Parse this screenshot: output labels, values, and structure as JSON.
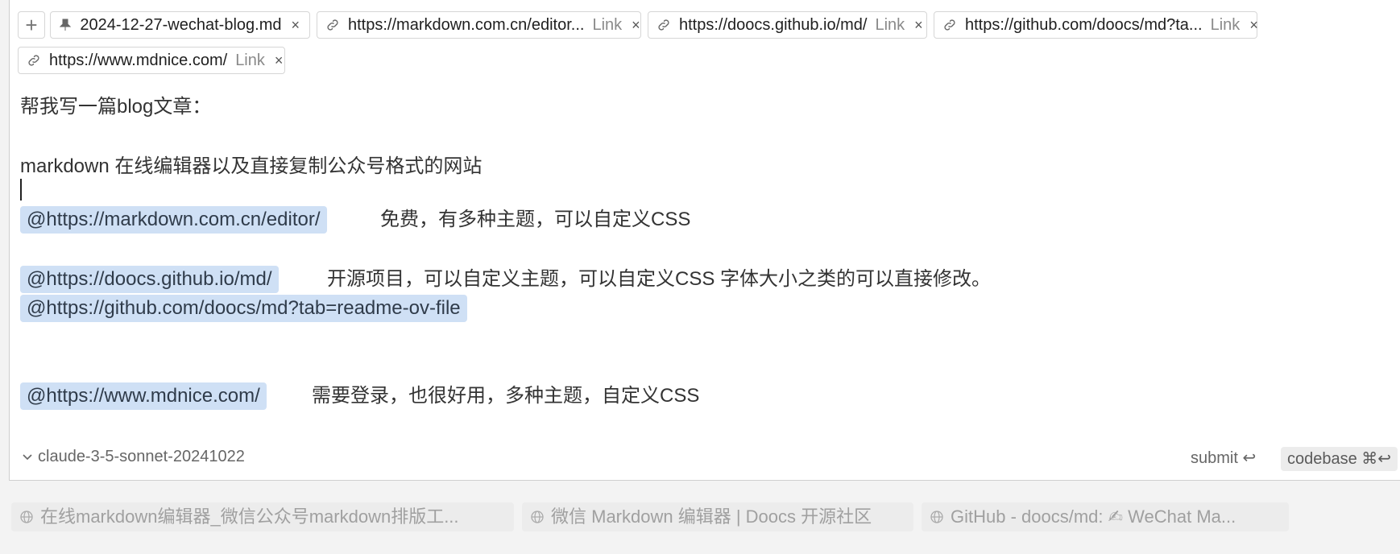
{
  "tabs": {
    "add_label": "+",
    "items": [
      {
        "title": "2024-12-27-wechat-blog.md",
        "kind": "file",
        "link_label": ""
      },
      {
        "title": "https://markdown.com.cn/editor...",
        "kind": "link",
        "link_label": "Link"
      },
      {
        "title": "https://doocs.github.io/md/",
        "kind": "link",
        "link_label": "Link"
      },
      {
        "title": "https://github.com/doocs/md?ta...",
        "kind": "link",
        "link_label": "Link"
      },
      {
        "title": "https://www.mdnice.com/",
        "kind": "link",
        "link_label": "Link"
      }
    ],
    "close_glyph": "×"
  },
  "editor": {
    "line1": "帮我写一篇blog文章：",
    "line2": "markdown 在线编辑器以及直接复制公众号格式的网站",
    "mentions": [
      {
        "text": "@https://markdown.com.cn/editor/",
        "desc": "免费，有多种主题，可以自定义CSS"
      },
      {
        "text": "@https://doocs.github.io/md/",
        "desc": "开源项目，可以自定义主题，可以自定义CSS 字体大小之类的可以直接修改。"
      },
      {
        "text": "@https://github.com/doocs/md?tab=readme-ov-file",
        "desc": ""
      },
      {
        "text": "@https://www.mdnice.com/",
        "desc": "需要登录，也很好用，多种主题，自定义CSS"
      }
    ]
  },
  "footer": {
    "model": "claude-3-5-sonnet-20241022",
    "submit_label": "submit ↩",
    "codebase_label": "codebase ⌘↩"
  },
  "suggestions": [
    "在线markdown编辑器_微信公众号markdown排版工...",
    "微信 Markdown 编辑器 | Doocs 开源社区",
    "GitHub - doocs/md: ✍ WeChat Ma..."
  ],
  "colors": {
    "mention_bg": "#cfe0f5",
    "page_bg": "#f3f3f3"
  }
}
